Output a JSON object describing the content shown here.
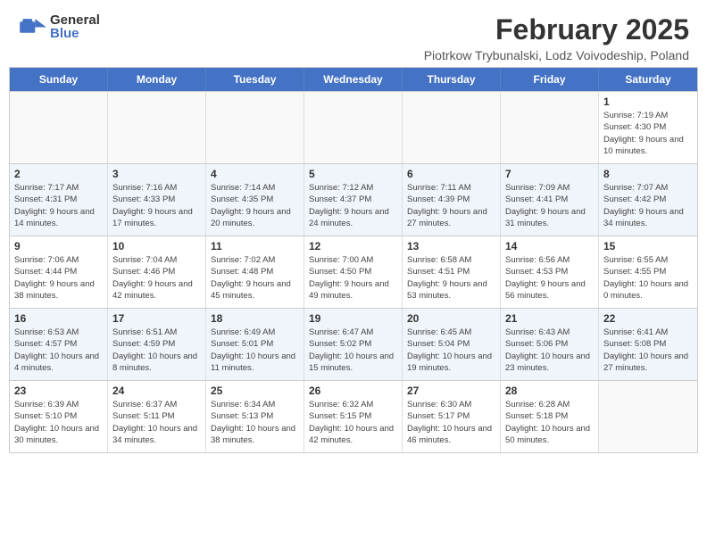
{
  "header": {
    "logo": {
      "general": "General",
      "blue": "Blue"
    },
    "title": "February 2025",
    "subtitle": "Piotrkow Trybunalski, Lodz Voivodeship, Poland"
  },
  "calendar": {
    "days_of_week": [
      "Sunday",
      "Monday",
      "Tuesday",
      "Wednesday",
      "Thursday",
      "Friday",
      "Saturday"
    ],
    "weeks": [
      [
        {
          "day": "",
          "info": "",
          "empty": true
        },
        {
          "day": "",
          "info": "",
          "empty": true
        },
        {
          "day": "",
          "info": "",
          "empty": true
        },
        {
          "day": "",
          "info": "",
          "empty": true
        },
        {
          "day": "",
          "info": "",
          "empty": true
        },
        {
          "day": "",
          "info": "",
          "empty": true
        },
        {
          "day": "1",
          "info": "Sunrise: 7:19 AM\nSunset: 4:30 PM\nDaylight: 9 hours and 10 minutes."
        }
      ],
      [
        {
          "day": "2",
          "info": "Sunrise: 7:17 AM\nSunset: 4:31 PM\nDaylight: 9 hours and 14 minutes."
        },
        {
          "day": "3",
          "info": "Sunrise: 7:16 AM\nSunset: 4:33 PM\nDaylight: 9 hours and 17 minutes."
        },
        {
          "day": "4",
          "info": "Sunrise: 7:14 AM\nSunset: 4:35 PM\nDaylight: 9 hours and 20 minutes."
        },
        {
          "day": "5",
          "info": "Sunrise: 7:12 AM\nSunset: 4:37 PM\nDaylight: 9 hours and 24 minutes."
        },
        {
          "day": "6",
          "info": "Sunrise: 7:11 AM\nSunset: 4:39 PM\nDaylight: 9 hours and 27 minutes."
        },
        {
          "day": "7",
          "info": "Sunrise: 7:09 AM\nSunset: 4:41 PM\nDaylight: 9 hours and 31 minutes."
        },
        {
          "day": "8",
          "info": "Sunrise: 7:07 AM\nSunset: 4:42 PM\nDaylight: 9 hours and 34 minutes."
        }
      ],
      [
        {
          "day": "9",
          "info": "Sunrise: 7:06 AM\nSunset: 4:44 PM\nDaylight: 9 hours and 38 minutes."
        },
        {
          "day": "10",
          "info": "Sunrise: 7:04 AM\nSunset: 4:46 PM\nDaylight: 9 hours and 42 minutes."
        },
        {
          "day": "11",
          "info": "Sunrise: 7:02 AM\nSunset: 4:48 PM\nDaylight: 9 hours and 45 minutes."
        },
        {
          "day": "12",
          "info": "Sunrise: 7:00 AM\nSunset: 4:50 PM\nDaylight: 9 hours and 49 minutes."
        },
        {
          "day": "13",
          "info": "Sunrise: 6:58 AM\nSunset: 4:51 PM\nDaylight: 9 hours and 53 minutes."
        },
        {
          "day": "14",
          "info": "Sunrise: 6:56 AM\nSunset: 4:53 PM\nDaylight: 9 hours and 56 minutes."
        },
        {
          "day": "15",
          "info": "Sunrise: 6:55 AM\nSunset: 4:55 PM\nDaylight: 10 hours and 0 minutes."
        }
      ],
      [
        {
          "day": "16",
          "info": "Sunrise: 6:53 AM\nSunset: 4:57 PM\nDaylight: 10 hours and 4 minutes."
        },
        {
          "day": "17",
          "info": "Sunrise: 6:51 AM\nSunset: 4:59 PM\nDaylight: 10 hours and 8 minutes."
        },
        {
          "day": "18",
          "info": "Sunrise: 6:49 AM\nSunset: 5:01 PM\nDaylight: 10 hours and 11 minutes."
        },
        {
          "day": "19",
          "info": "Sunrise: 6:47 AM\nSunset: 5:02 PM\nDaylight: 10 hours and 15 minutes."
        },
        {
          "day": "20",
          "info": "Sunrise: 6:45 AM\nSunset: 5:04 PM\nDaylight: 10 hours and 19 minutes."
        },
        {
          "day": "21",
          "info": "Sunrise: 6:43 AM\nSunset: 5:06 PM\nDaylight: 10 hours and 23 minutes."
        },
        {
          "day": "22",
          "info": "Sunrise: 6:41 AM\nSunset: 5:08 PM\nDaylight: 10 hours and 27 minutes."
        }
      ],
      [
        {
          "day": "23",
          "info": "Sunrise: 6:39 AM\nSunset: 5:10 PM\nDaylight: 10 hours and 30 minutes."
        },
        {
          "day": "24",
          "info": "Sunrise: 6:37 AM\nSunset: 5:11 PM\nDaylight: 10 hours and 34 minutes."
        },
        {
          "day": "25",
          "info": "Sunrise: 6:34 AM\nSunset: 5:13 PM\nDaylight: 10 hours and 38 minutes."
        },
        {
          "day": "26",
          "info": "Sunrise: 6:32 AM\nSunset: 5:15 PM\nDaylight: 10 hours and 42 minutes."
        },
        {
          "day": "27",
          "info": "Sunrise: 6:30 AM\nSunset: 5:17 PM\nDaylight: 10 hours and 46 minutes."
        },
        {
          "day": "28",
          "info": "Sunrise: 6:28 AM\nSunset: 5:18 PM\nDaylight: 10 hours and 50 minutes."
        },
        {
          "day": "",
          "info": "",
          "empty": true
        }
      ]
    ]
  }
}
